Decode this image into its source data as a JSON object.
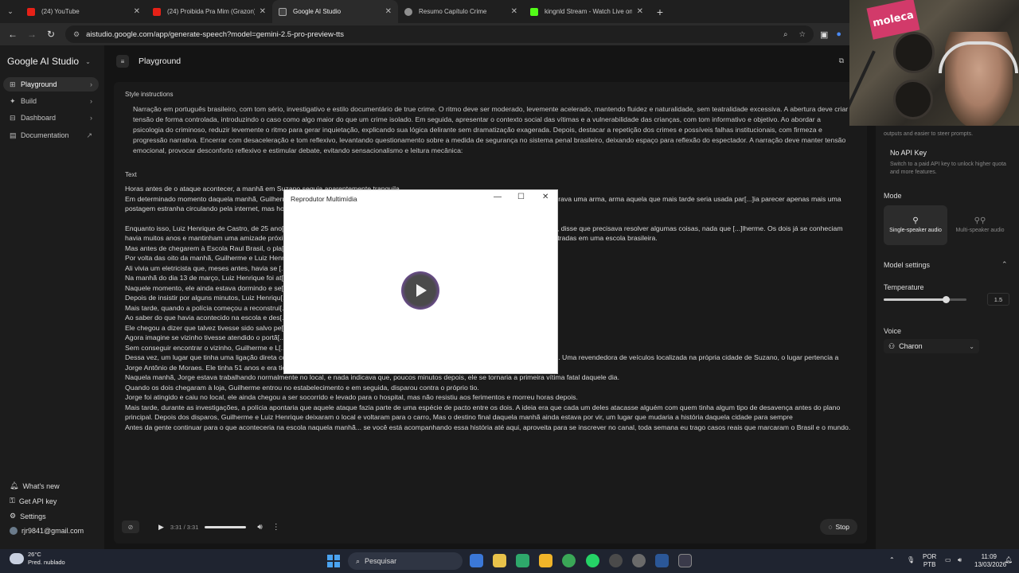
{
  "browser": {
    "tabs": [
      {
        "title": "(24) YouTube",
        "color": "#e62117",
        "active": false
      },
      {
        "title": "(24) Proibida Pra Mim (Grazon)",
        "color": "#e62117",
        "active": false
      },
      {
        "title": "Google AI Studio",
        "color": "#444444",
        "active": true
      },
      {
        "title": "Resumo Capítulo Crime",
        "color": "#8f8f8f",
        "active": false
      },
      {
        "title": "kingnld Stream - Watch Live on",
        "color": "#53fc18",
        "active": false
      }
    ],
    "new_tab": "+",
    "url": "aistudio.google.com/app/generate-speech?model=gemini-2.5-pro-preview-tts"
  },
  "sidebar": {
    "brand": "Google AI Studio",
    "items": [
      {
        "label": "Playground",
        "icon": "playground-icon"
      },
      {
        "label": "Build",
        "icon": "build-icon"
      },
      {
        "label": "Dashboard",
        "icon": "dashboard-icon"
      },
      {
        "label": "Documentation",
        "icon": "documentation-icon"
      }
    ],
    "footer": {
      "whats_new": "What's new",
      "get_api_key": "Get API key",
      "settings": "Settings",
      "email": "rjr9841@gmail.com"
    }
  },
  "main": {
    "title": "Playground",
    "style_label": "Style instructions",
    "style_text": "Narração em português brasileiro, com tom sério, investigativo e estilo documentário de true crime. O ritmo deve ser moderado, levemente acelerado, mantendo fluidez e naturalidade, sem teatralidade excessiva. A abertura deve criar tensão de forma controlada, introduzindo o caso como algo maior do que um crime isolado. Em seguida, apresentar o contexto social das vítimas e a vulnerabilidade das crianças, com tom informativo e objetivo. Ao abordar a psicologia do criminoso, reduzir levemente o ritmo para gerar inquietação, explicando sua lógica delirante sem dramatização exagerada. Depois, destacar a repetição dos crimes e possíveis falhas institucionais, com firmeza e progressão narrativa. Encerrar com desaceleração e tom reflexivo, levantando questionamento sobre a medida de segurança no sistema penal brasileiro, deixando espaço para reflexão do espectador. A narração deve manter tensão emocional, provocar desconforto reflexivo e estimular debate, evitando sensacionalismo e leitura mecânica:",
    "text_label": "Text",
    "text_paragraphs": [
      {
        "text": "Horas antes de o ataque acontecer, a manhã em Suzano seguia aparentemente tranquila",
        "dim": false,
        "gap": false
      },
      {
        "text": "Em determinado momento daquela manhã, Guilherme [...] imagens, ele aparece usando uma máscara de caveira e em várias fotos, ele segurava uma arma, arma aquela que mais tarde seria usada par[...]ia parecer apenas mais uma postagem estranha circulando pela internet, mas horas depois, aquelas imagens passariam a ser vistas de um fo[...]",
        "dim": false,
        "gap": false
      },
      {
        "text": "Enquanto isso, Luiz Henrique de Castro, de 25 ano[...] leste de São Paulo, mas aquela manhã, porém, pediu para sair mais cedo do trabalho, disse que precisava resolver algumas coisas, nada que [...]lherme. Os dois já se conheciam havia muitos anos e mantinham uma amizade próxima e naquela manhã, eles sairiam juntos dali, e começa[...]das maiores tragédias já registradas em uma escola brasileira.",
        "dim": false,
        "gap": true
      },
      {
        "text": "Mas antes de chegarem à Escola Raul Brasil, o pla[...]",
        "dim": false,
        "gap": false
      },
      {
        "text": "Por volta das oito da manhã, Guilherme e Luiz Henr[...] região onde Luiz Henrique morava.",
        "dim": false,
        "gap": false
      },
      {
        "text": "Ali vivia um eletricista que, meses antes, havia se [...]egou a intervir para separar uma discussão entre Luiz Henrique e o próprio pai.",
        "dim": false,
        "gap": false
      },
      {
        "text": "Na manhã do dia 13 de março, Luiz Henrique foi at[...]apareceu.",
        "dim": false,
        "gap": false
      },
      {
        "text": "Naquele momento, ele ainda estava dormindo e se[...]",
        "dim": false,
        "gap": false
      },
      {
        "text": "Depois de insistir por alguns minutos, Luiz Henriqu[...]",
        "dim": false,
        "gap": false
      },
      {
        "text": "Mais tarde, quando a polícia começou a reconstrui[...]a primeira vítima do plano.",
        "dim": false,
        "gap": false
      },
      {
        "text": "Ao saber do que havia acontecido na escola e des[...]",
        "dim": false,
        "gap": false
      },
      {
        "text": "Ele chegou a dizer que talvez tivesse sido salvo pe[...]",
        "dim": false,
        "gap": false
      },
      {
        "text": "Agora imagine se vizinho tivesse atendido o portã[...]",
        "dim": false,
        "gap": false
      },
      {
        "text": "Sem conseguir encontrar o vizinho, Guilherme e L[...]",
        "dim": false,
        "gap": false
      },
      {
        "text": "Dessa vez, um lugar que tinha uma ligação direta com um deles. Depois de saírem da casa do vizinho, eles seguiram para o próximo destino. Uma revendedora de veículos localizada na própria cidade de Suzano, o lugar pertencia a Jorge Antônio de Moraes. Ele tinha 51 anos e era tio de Guilherme.",
        "dim": false,
        "gap": false
      },
      {
        "text": "Naquela manhã, Jorge estava trabalhando normalmente no local, e nada indicava que, poucos minutos depois, ele se tornaria a primeira vítima fatal daquele dia.",
        "dim": false,
        "gap": false
      },
      {
        "text": "Quando os dois chegaram à loja, Guilherme entrou no estabelecimento e em seguida, disparou contra o próprio tio.",
        "dim": false,
        "gap": false
      },
      {
        "text": "Jorge foi atingido e caiu no local, ele ainda chegou a ser socorrido e levado para o hospital, mas não resistiu aos ferimentos e morreu horas depois.",
        "dim": false,
        "gap": false
      },
      {
        "text": "Mais tarde, durante as investigações, a polícia apontaria que aquele ataque fazia parte de uma espécie de pacto entre os dois. A ideia era que cada um deles atacasse alguém com quem tinha algum tipo de desavença antes do plano principal. Depois dos disparos, Guilherme e Luiz Henrique deixaram o local e voltaram para o carro, Mas o destino final daquela manhã ainda estava por vir, um lugar que mudaria a história daquela cidade para sempre",
        "dim": false,
        "gap": false
      },
      {
        "text": "Antes da gente continuar para o que aconteceria na escola naquela manhã... se você está acompanhando essa história até aqui, aproveita para se inscrever no canal, toda semana eu trago casos reais que marcaram o Brasil e o mundo.",
        "dim": false,
        "gap": false
      }
    ]
  },
  "player": {
    "time": "3:31 / 3:31",
    "stop_label": "Stop"
  },
  "right_panel": {
    "steer_text": "outputs and easier to steer prompts.",
    "no_api_title": "No API Key",
    "no_api_desc": "Switch to a paid API key to unlock higher quota and more features.",
    "mode_label": "Mode",
    "mode_single": "Single-speaker audio",
    "mode_multi": "Multi-speaker audio",
    "model_settings": "Model settings",
    "temperature_label": "Temperature",
    "temperature_value": "1.5",
    "temperature_fraction": 0.75,
    "voice_label": "Voice",
    "voice_value": "Charon"
  },
  "webcam": {
    "sign_text": "moleca"
  },
  "media_player": {
    "title": "Reprodutor Multimídia"
  },
  "taskbar": {
    "temp": "26°C",
    "weather": "Pred. nublado",
    "search_placeholder": "Pesquisar",
    "lang": "POR",
    "kb": "PTB",
    "time": "11:09",
    "date": "13/03/2026"
  }
}
